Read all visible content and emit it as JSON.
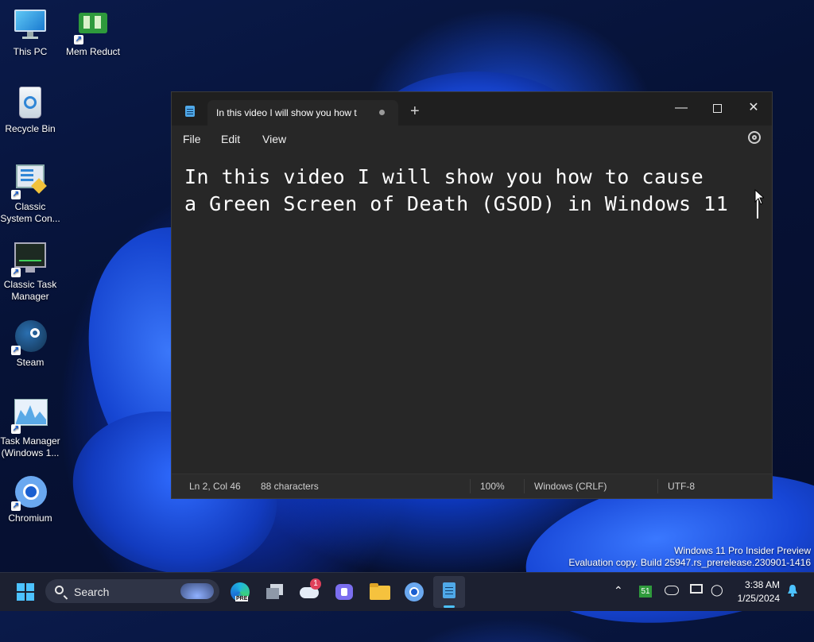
{
  "desktop": {
    "icons": [
      {
        "label": "This PC",
        "icon": "monitor-icon"
      },
      {
        "label": "Mem Reduct",
        "icon": "memory-chip-icon"
      },
      {
        "label": "Recycle Bin",
        "icon": "recycle-bin-icon"
      },
      {
        "label": "Classic System Con...",
        "icon": "control-panel-icon"
      },
      {
        "label": "Classic Task Manager",
        "icon": "task-manager-icon"
      },
      {
        "label": "Steam",
        "icon": "steam-icon"
      },
      {
        "label": "Task Manager (Windows 1...",
        "icon": "task-manager-graph-icon"
      },
      {
        "label": "Chromium",
        "icon": "chromium-icon"
      }
    ]
  },
  "notepad": {
    "tab_title": "In this video I will show you how t",
    "menu": [
      "File",
      "Edit",
      "View"
    ],
    "lines": [
      "In this video I will show you how to cause",
      "a Green Screen of Death (GSOD) in Windows 11"
    ],
    "status": {
      "position": "Ln 2, Col 46",
      "characters": "88 characters",
      "zoom": "100%",
      "line_ending": "Windows (CRLF)",
      "encoding": "UTF-8"
    }
  },
  "watermark": {
    "line1": "Windows 11 Pro Insider Preview",
    "line2": "Evaluation copy. Build 25947.rs_prerelease.230901-1416"
  },
  "taskbar": {
    "search_label": "Search",
    "notification_badge": "1",
    "tray_number": "51",
    "time": "3:38 AM",
    "date": "1/25/2024"
  },
  "colors": {
    "editor_bg": "#272727",
    "taskbar_bg": "#1c2030",
    "accent_blue": "#1a5cff"
  }
}
